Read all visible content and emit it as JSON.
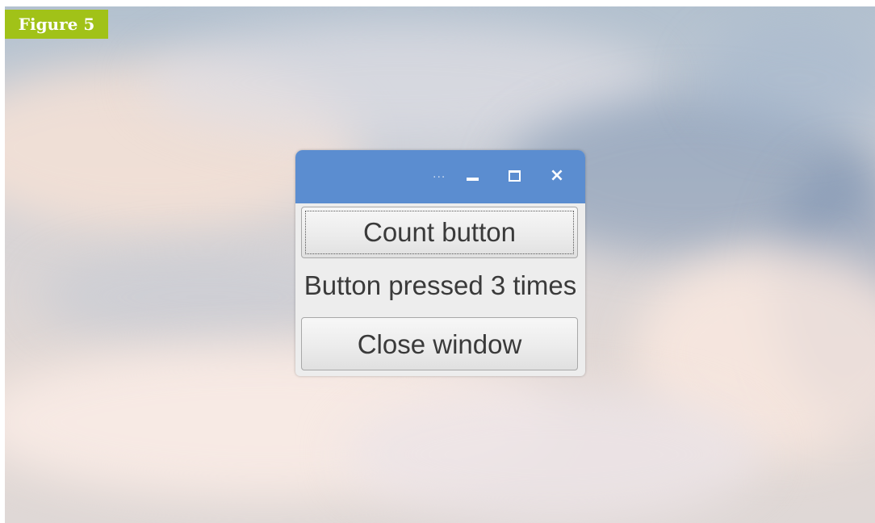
{
  "figure_label": "Figure 5",
  "window": {
    "title_ellipsis": "...",
    "close_glyph": "×",
    "count_button_label": "Count button",
    "status_text": "Button pressed 3 times",
    "close_window_label": "Close window"
  },
  "colors": {
    "titlebar": "#5b8dd0",
    "figure_label_bg": "#a1c218",
    "window_bg": "#ededed"
  },
  "icons": {
    "minimize": "minimize-icon",
    "maximize": "maximize-icon",
    "close": "close-icon"
  }
}
